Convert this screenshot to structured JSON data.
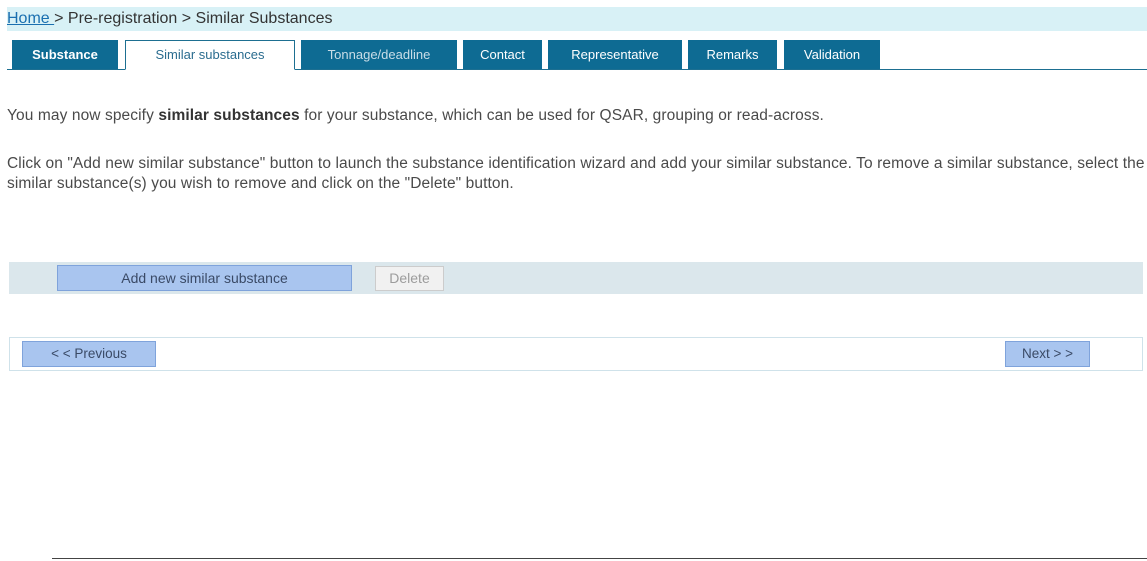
{
  "breadcrumb": {
    "home": "Home ",
    "sep1": "> Pre-registration > Similar Substances"
  },
  "tabs": [
    {
      "label": "Substance",
      "state": "bold"
    },
    {
      "label": "Similar substances",
      "state": "active"
    },
    {
      "label": "Tonnage/deadline",
      "state": "faded"
    },
    {
      "label": "Contact",
      "state": "normal"
    },
    {
      "label": "Representative",
      "state": "normal"
    },
    {
      "label": "Remarks",
      "state": "normal"
    },
    {
      "label": "Validation",
      "state": "normal"
    }
  ],
  "intro": {
    "line1_pre": "You may now specify ",
    "line1_bold": "similar substances",
    "line1_post": " for your substance, which can be used for QSAR, grouping or read-across.",
    "paragraph2": "Click on \"Add new similar substance\" button to launch the substance identification wizard and add your similar substance. To remove a similar substance, select the similar substance(s) you wish to remove and click on the \"Delete\" button."
  },
  "actions": {
    "add_label": "Add new similar substance",
    "delete_label": "Delete"
  },
  "navigation": {
    "previous_label": "< < Previous",
    "next_label": "Next > >"
  },
  "colors": {
    "tab_dark": "#0e6b93",
    "breadcrumb_bg": "#d8f1f6",
    "button_bg": "#a9c5ef"
  }
}
